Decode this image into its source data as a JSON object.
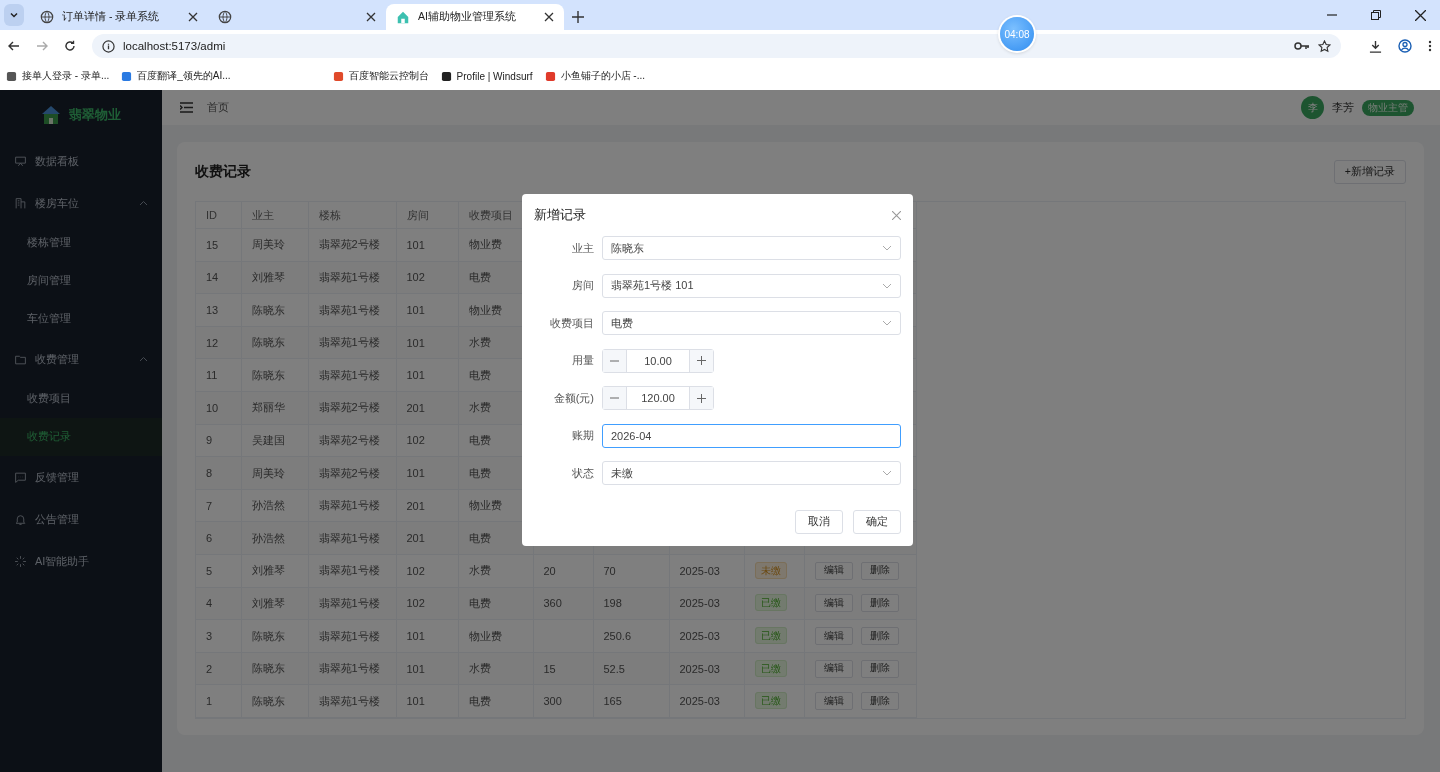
{
  "browser": {
    "tabs": [
      {
        "title": "订单详情 - 录单系统",
        "selected": false
      },
      {
        "selected": false
      },
      {
        "title": "AI辅助物业管理系统",
        "selected": true
      }
    ],
    "address": "localhost:5173/admi",
    "bookmarks": [
      "接单人登录 - 录单...",
      "百度翻译_领先的AI...",
      "百度智能云控制台",
      "Profile | Windsurf",
      "小鱼铺子的小店 -..."
    ],
    "timer": "04:08"
  },
  "sidebar": {
    "brand": "翡翠物业",
    "items": [
      {
        "label": "数据看板",
        "selected": false
      },
      {
        "label": "楼房车位",
        "expanded": true,
        "children": [
          {
            "label": "楼栋管理",
            "selected": false
          },
          {
            "label": "房间管理",
            "selected": false
          },
          {
            "label": "车位管理",
            "selected": false
          }
        ]
      },
      {
        "label": "收费管理",
        "expanded": true,
        "children": [
          {
            "label": "收费项目",
            "selected": false
          },
          {
            "label": "收费记录",
            "selected": true
          }
        ]
      },
      {
        "label": "反馈管理",
        "selected": false
      },
      {
        "label": "公告管理",
        "selected": false
      },
      {
        "label": "AI智能助手",
        "selected": false
      }
    ]
  },
  "header": {
    "breadcrumb": "首页",
    "user": {
      "avatar": "李",
      "name": "李芳",
      "role": "物业主管"
    }
  },
  "page": {
    "title": "收费记录",
    "add_button": "+新增记录"
  },
  "table": {
    "columns": [
      "ID",
      "业主",
      "楼栋",
      "房间",
      "收费项目"
    ],
    "rows": [
      {
        "id": "15",
        "owner": "周美玲",
        "building": "翡翠苑2号楼",
        "room": "101",
        "item": "物业费"
      },
      {
        "id": "14",
        "owner": "刘雅琴",
        "building": "翡翠苑1号楼",
        "room": "102",
        "item": "电费"
      },
      {
        "id": "13",
        "owner": "陈晓东",
        "building": "翡翠苑1号楼",
        "room": "101",
        "item": "物业费"
      },
      {
        "id": "12",
        "owner": "陈晓东",
        "building": "翡翠苑1号楼",
        "room": "101",
        "item": "水费"
      },
      {
        "id": "11",
        "owner": "陈晓东",
        "building": "翡翠苑1号楼",
        "room": "101",
        "item": "电费"
      },
      {
        "id": "10",
        "owner": "郑丽华",
        "building": "翡翠苑2号楼",
        "room": "201",
        "item": "水费"
      },
      {
        "id": "9",
        "owner": "吴建国",
        "building": "翡翠苑2号楼",
        "room": "102",
        "item": "电费"
      },
      {
        "id": "8",
        "owner": "周美玲",
        "building": "翡翠苑2号楼",
        "room": "101",
        "item": "电费"
      },
      {
        "id": "7",
        "owner": "孙浩然",
        "building": "翡翠苑1号楼",
        "room": "201",
        "item": "物业费"
      },
      {
        "id": "6",
        "owner": "孙浩然",
        "building": "翡翠苑1号楼",
        "room": "201",
        "item": "电费"
      },
      {
        "id": "5",
        "owner": "刘雅琴",
        "building": "翡翠苑1号楼",
        "room": "102",
        "item": "水费",
        "column_6": "20",
        "column_7": "70",
        "column_8": "2025-03",
        "status": {
          "label": "未缴",
          "kind": "unpaid"
        },
        "actions": [
          "编辑",
          "删除"
        ]
      },
      {
        "id": "4",
        "owner": "刘雅琴",
        "building": "翡翠苑1号楼",
        "room": "102",
        "item": "电费",
        "column_6": "360",
        "column_7": "198",
        "column_8": "2025-03",
        "status": {
          "label": "已缴",
          "kind": "paid"
        },
        "actions": [
          "编辑",
          "删除"
        ]
      },
      {
        "id": "3",
        "owner": "陈晓东",
        "building": "翡翠苑1号楼",
        "room": "101",
        "item": "物业费",
        "column_7": "250.6",
        "column_8": "2025-03",
        "status": {
          "label": "已缴",
          "kind": "paid"
        },
        "actions": [
          "编辑",
          "删除"
        ]
      },
      {
        "id": "2",
        "owner": "陈晓东",
        "building": "翡翠苑1号楼",
        "room": "101",
        "item": "水费",
        "column_6": "15",
        "column_7": "52.5",
        "column_8": "2025-03",
        "status": {
          "label": "已缴",
          "kind": "paid"
        },
        "actions": [
          "编辑",
          "删除"
        ]
      },
      {
        "id": "1",
        "owner": "陈晓东",
        "building": "翡翠苑1号楼",
        "room": "101",
        "item": "电费",
        "column_6": "300",
        "column_7": "165",
        "column_8": "2025-03",
        "status": {
          "label": "已缴",
          "kind": "paid"
        },
        "actions": [
          "编辑",
          "删除"
        ]
      }
    ]
  },
  "dialog": {
    "title": "新增记录",
    "fields": [
      {
        "label": "业主",
        "kind": "select",
        "value": "陈晓东"
      },
      {
        "label": "房间",
        "kind": "select",
        "value": "翡翠苑1号楼 101"
      },
      {
        "label": "收费项目",
        "kind": "select",
        "value": "电费"
      },
      {
        "label": "用量",
        "kind": "number",
        "value": "10.00"
      },
      {
        "label": "金额(元)",
        "kind": "number",
        "value": "120.00"
      },
      {
        "label": "账期",
        "kind": "text",
        "value": "2026-04",
        "focused": true
      },
      {
        "label": "状态",
        "kind": "select",
        "value": "未缴"
      }
    ],
    "buttons": [
      "取消",
      "确定"
    ]
  }
}
